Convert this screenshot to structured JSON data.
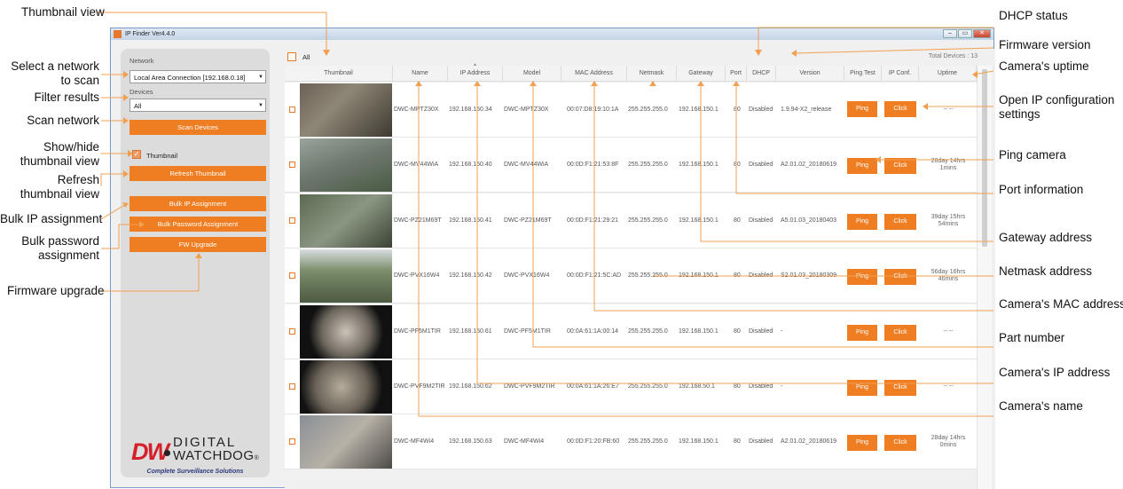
{
  "window": {
    "title": "IP Finder Ver4.4.0",
    "controls": [
      "–",
      "▭",
      "✕"
    ]
  },
  "sidebar": {
    "network_label": "Network",
    "network_value": "Local Area Connection [192.168.0.18]",
    "devices_label": "Devices",
    "devices_value": "All",
    "scan_button": "Scan Devices",
    "thumbnail_checkbox_label": "Thumbnail",
    "refresh_button": "Refresh Thumbnail",
    "bulk_ip_button": "Bulk IP Assignment",
    "bulk_password_button": "Bulk Password Assignment",
    "fw_button": "FW Upgrade",
    "logo_dw": "DW",
    "logo_line1": "DIGITAL",
    "logo_line2": "WATCHDOG",
    "logo_reg": "®",
    "tagline": "Complete Surveillance Solutions"
  },
  "table": {
    "all_label": "All",
    "total_devices": "Total Devices : 13",
    "headers": [
      "Thumbnail",
      "Name",
      "IP Address",
      "Model",
      "MAC Address",
      "Netmask",
      "Gateway",
      "Port",
      "DHCP",
      "Version",
      "Ping Test",
      "IP Conf.",
      "Uptime"
    ],
    "ping_label": "Ping",
    "click_label": "Click",
    "rows": [
      {
        "name": "DWC-MPTZ30X",
        "ip": "192.168.150.34",
        "model": "DWC-MPTZ30X",
        "mac": "00:07:D8:19:10:1A",
        "netmask": "255.255.255.0",
        "gateway": "192.168.150.1",
        "port": "80",
        "dhcp": "Disabled",
        "version": "1.9.94-X2_release",
        "uptime1": "-- --",
        "uptime2": ""
      },
      {
        "name": "DWC-MV44WiA",
        "ip": "192.168.150.40",
        "model": "DWC-MV44WiA",
        "mac": "00:0D:F1:21:53:8F",
        "netmask": "255.255.255.0",
        "gateway": "192.168.150.1",
        "port": "80",
        "dhcp": "Disabled",
        "version": "A2.01.02_20180619",
        "uptime1": "28day 14hrs",
        "uptime2": "1mins"
      },
      {
        "name": "DWC-PZ21M69T",
        "ip": "192.168.150.41",
        "model": "DWC-PZ21M69T",
        "mac": "00:0D:F1:21:29:21",
        "netmask": "255.255.255.0",
        "gateway": "192.168.150.1",
        "port": "80",
        "dhcp": "Disabled",
        "version": "A5.01.03_20180403",
        "uptime1": "39day 15hrs",
        "uptime2": "54mins"
      },
      {
        "name": "DWC-PVX16W4",
        "ip": "192.168.150.42",
        "model": "DWC-PVX16W4",
        "mac": "00:0D:F1:21:5C:AD",
        "netmask": "255.255.255.0",
        "gateway": "192.168.150.1",
        "port": "80",
        "dhcp": "Disabled",
        "version": "S2.01.03_20180309",
        "uptime1": "56day 16hrs",
        "uptime2": "46mins"
      },
      {
        "name": "DWC-PF5M1TIR",
        "ip": "192.168.150.61",
        "model": "DWC-PF5M1TIR",
        "mac": "00:0A:61:1A:00:14",
        "netmask": "255.255.255.0",
        "gateway": "192.168.150.1",
        "port": "80",
        "dhcp": "Disabled",
        "version": "-",
        "uptime1": "-- --",
        "uptime2": ""
      },
      {
        "name": "DWC-PVF9M2TIR",
        "ip": "192.168.150.62",
        "model": "DWC-PVF9M2TIR",
        "mac": "00:0A:61:1A:26:E7",
        "netmask": "255.255.255.0",
        "gateway": "192.168.50.1",
        "port": "80",
        "dhcp": "Disabled",
        "version": "-",
        "uptime1": "-- --",
        "uptime2": ""
      },
      {
        "name": "DWC-MF4Wi4",
        "ip": "192.168.150.63",
        "model": "DWC-MF4Wi4",
        "mac": "00:0D:F1:20:FB:60",
        "netmask": "255.255.255.0",
        "gateway": "192.168.150.1",
        "port": "80",
        "dhcp": "Disabled",
        "version": "A2.01.02_20180619",
        "uptime1": "28day 14hrs",
        "uptime2": "0mins"
      }
    ]
  },
  "annotations": {
    "thumbnail_view": "Thumbnail view",
    "select_network": "Select a network\nto scan",
    "filter_results": "Filter results",
    "scan_network": "Scan network",
    "show_hide": "Show/hide\nthumbnail view",
    "refresh": "Refresh\nthumbnail view",
    "bulk_ip": "Bulk IP assignment",
    "bulk_password": "Bulk password\nassignment",
    "firmware_upgrade": "Firmware upgrade",
    "dhcp_status": "DHCP status",
    "firmware_version": "Firmware version",
    "uptime": "Camera's uptime",
    "open_ip_config": "Open IP configuration\nsettings",
    "ping_camera": "Ping camera",
    "port_info": "Port information",
    "gateway": "Gateway address",
    "netmask": "Netmask address",
    "mac": "Camera's MAC address",
    "part_number": "Part number",
    "ip_address": "Camera's IP address",
    "camera_name": "Camera's name"
  },
  "colors": {
    "accent": "#ef7d22",
    "arrow": "#f0a050",
    "logo_red": "#d4202a",
    "tagline_blue": "#2d3a7d"
  }
}
